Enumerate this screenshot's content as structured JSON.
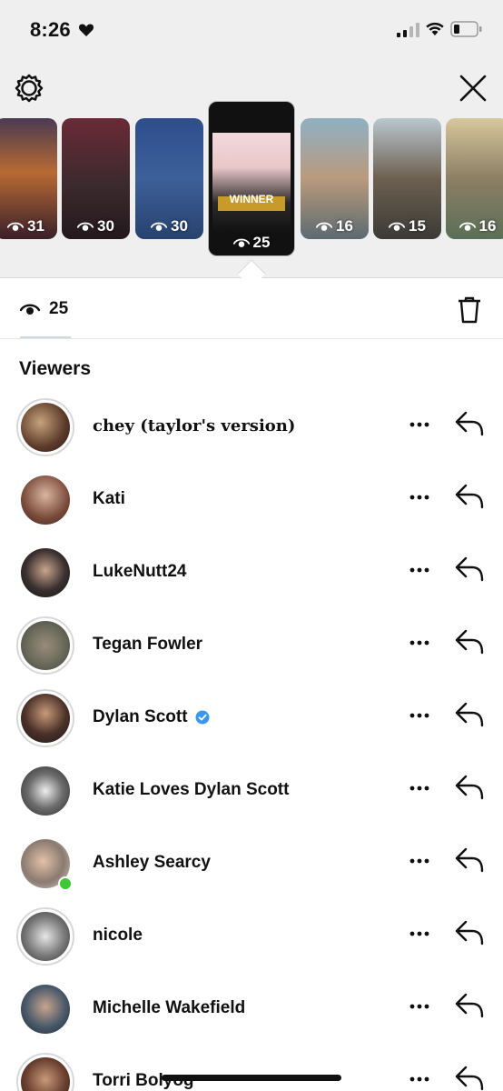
{
  "status_bar": {
    "time": "8:26",
    "heart_icon": "heart-icon",
    "signal_icon": "cellular-signal-icon",
    "wifi_icon": "wifi-icon",
    "battery_icon": "battery-icon"
  },
  "header": {
    "settings_icon": "gear-icon",
    "close_icon": "close-icon"
  },
  "stories": [
    {
      "views": "31"
    },
    {
      "views": "30"
    },
    {
      "views": "30"
    },
    {
      "views": "25",
      "selected": true,
      "badge": "WINNER"
    },
    {
      "views": "16"
    },
    {
      "views": "15"
    },
    {
      "views": "16"
    }
  ],
  "summary": {
    "view_count": "25",
    "eye_icon": "eye-icon",
    "delete_icon": "trash-icon"
  },
  "viewers_title": "Viewers",
  "viewers": [
    {
      "name": "chey (taylor's version)"
    },
    {
      "name": "Kati"
    },
    {
      "name": "LukeNutt24"
    },
    {
      "name": "Tegan Fowler"
    },
    {
      "name": "Dylan Scott",
      "verified": true
    },
    {
      "name": "Katie Loves Dylan Scott"
    },
    {
      "name": "Ashley Searcy",
      "online": true
    },
    {
      "name": "nicole"
    },
    {
      "name": "Michelle Wakefield"
    },
    {
      "name": "Torri Bolyog"
    }
  ],
  "colors": {
    "verified": "#3897f0",
    "online": "#3ec838",
    "panel_bg": "#efefef"
  }
}
